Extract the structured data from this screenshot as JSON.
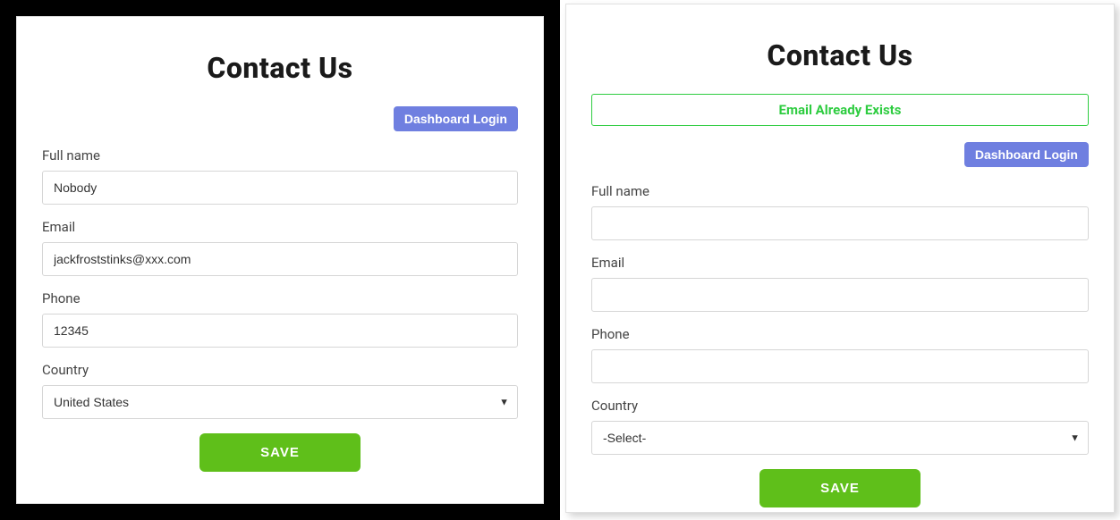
{
  "left": {
    "title": "Contact Us",
    "dashboard_login": "Dashboard Login",
    "labels": {
      "fullname": "Full name",
      "email": "Email",
      "phone": "Phone",
      "country": "Country"
    },
    "values": {
      "fullname": "Nobody",
      "email": "jackfroststinks@xxx.com",
      "phone": "12345",
      "country": "United States"
    },
    "save_label": "SAVE"
  },
  "right": {
    "title": "Contact Us",
    "alert": "Email Already Exists",
    "dashboard_login": "Dashboard Login",
    "labels": {
      "fullname": "Full name",
      "email": "Email",
      "phone": "Phone",
      "country": "Country"
    },
    "values": {
      "fullname": "",
      "email": "",
      "phone": "",
      "country": "-Select-"
    },
    "save_label": "SAVE"
  }
}
